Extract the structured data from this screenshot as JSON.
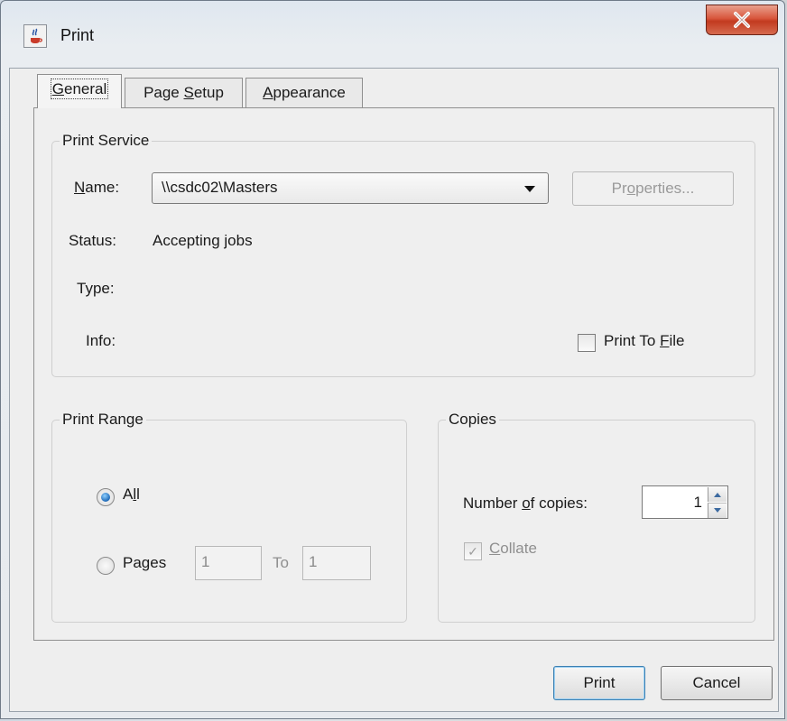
{
  "window": {
    "title": "Print",
    "close_glyph": "X"
  },
  "tabs": [
    {
      "label": "General",
      "underline": "G",
      "active": true
    },
    {
      "label": "Page Setup",
      "underline": "S"
    },
    {
      "label": "Appearance",
      "underline": "A"
    }
  ],
  "print_service": {
    "group_title": "Print Service",
    "name_label": "Name:",
    "name_value": "\\\\csdc02\\Masters",
    "properties_button": "Properties...",
    "status_label": "Status:",
    "status_value": "Accepting jobs",
    "type_label": "Type:",
    "info_label": "Info:",
    "print_to_file_label": "Print To File",
    "print_to_file_checked": false
  },
  "print_range": {
    "group_title": "Print Range",
    "all_label": "All",
    "pages_label": "Pages",
    "selected": "All",
    "from_value": "1",
    "to_label": "To",
    "to_value": "1"
  },
  "copies": {
    "group_title": "Copies",
    "number_label": "Number of copies:",
    "number_value": "1",
    "collate_label": "Collate",
    "collate_checked": true
  },
  "footer": {
    "print_button": "Print",
    "cancel_button": "Cancel"
  }
}
